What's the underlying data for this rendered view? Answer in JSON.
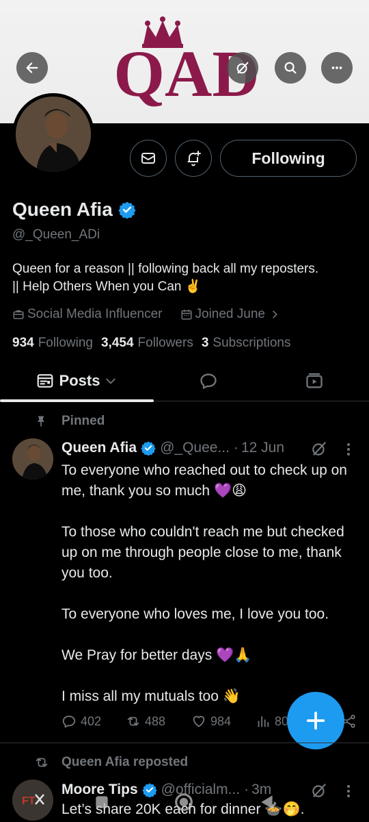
{
  "banner": {
    "logo_text": "QAD"
  },
  "profile": {
    "display_name": "Queen Afia",
    "handle": "@_Queen_ADi",
    "bio_line1": "Queen for a reason || following back all my reposters.",
    "bio_line2": "|| Help Others When you Can ✌️",
    "category": "Social Media Influencer",
    "joined": "Joined June",
    "following_count": "934",
    "following_label": "Following",
    "followers_count": "3,454",
    "followers_label": "Followers",
    "subscriptions_count": "3",
    "subscriptions_label": "Subscriptions",
    "follow_button_label": "Following"
  },
  "tabs": {
    "posts_label": "Posts"
  },
  "pinned_post": {
    "pinned_label": "Pinned",
    "author_name": "Queen Afia",
    "author_handle": "@_Quee...",
    "dot": "·",
    "date": "12 Jun",
    "paragraphs": [
      "To everyone who reached out to check up on me, thank you so much 💜😩",
      "To those who couldn't reach me but checked up on me through people close to me, thank you too.",
      "To everyone who loves me, I love you too.",
      "We Pray for better days 💜🙏",
      "I miss all my mutuals too 👋"
    ],
    "replies": "402",
    "reposts": "488",
    "likes": "984",
    "views": "80"
  },
  "repost": {
    "label": "Queen Afia reposted",
    "author_name": "Moore Tips",
    "author_handle": "@officialm...",
    "dot": "·",
    "date": "3m",
    "text": "Let’s share 20K each for dinner 🍲🤭."
  },
  "colors": {
    "accent": "#1d9bf0",
    "brand_maroon": "#8b1a4a",
    "background": "#000000",
    "muted_text": "#71767b"
  },
  "icons": [
    "back-arrow-icon",
    "grok-icon",
    "search-icon",
    "more-icon",
    "mail-icon",
    "bell-plus-icon",
    "verified-badge-icon",
    "briefcase-icon",
    "calendar-icon",
    "chevron-right-icon",
    "posts-tab-icon",
    "chevron-down-icon",
    "reply-icon",
    "media-icon",
    "pin-icon",
    "repost-icon",
    "heart-icon",
    "views-icon",
    "share-icon",
    "plus-icon"
  ]
}
